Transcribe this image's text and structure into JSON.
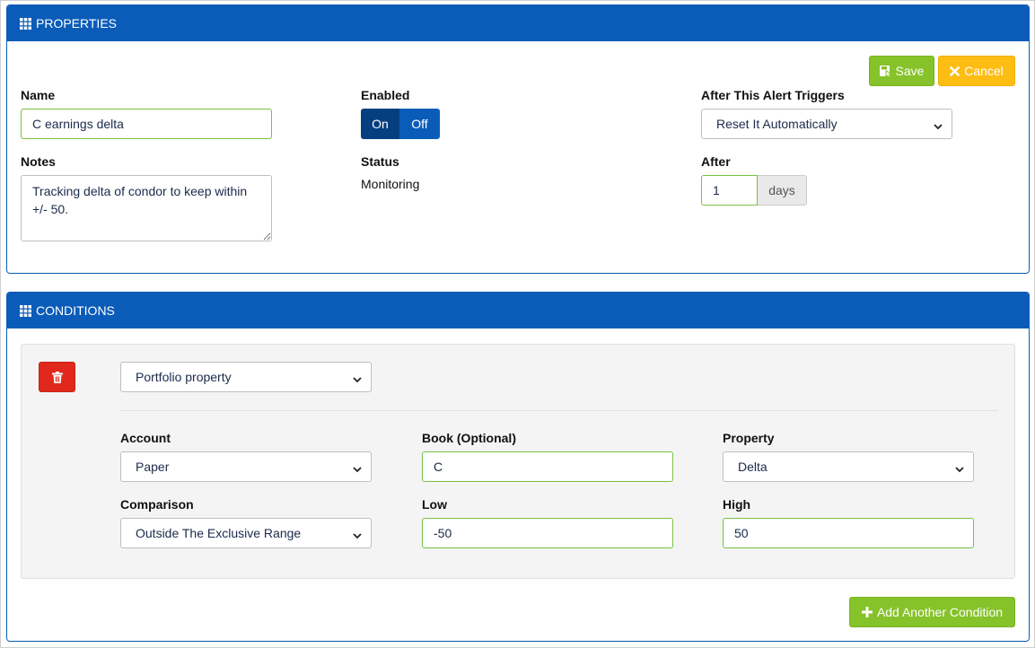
{
  "properties": {
    "header": "PROPERTIES",
    "save_label": "Save",
    "cancel_label": "Cancel",
    "name_label": "Name",
    "name_value": "C earnings delta",
    "notes_label": "Notes",
    "notes_value": "Tracking delta of condor to keep within +/- 50.",
    "enabled_label": "Enabled",
    "toggle_on": "On",
    "toggle_off": "Off",
    "status_label": "Status",
    "status_value": "Monitoring",
    "after_triggers_label": "After This Alert Triggers",
    "after_triggers_value": "Reset It Automatically",
    "after_label": "After",
    "after_value": "1",
    "after_unit": "days"
  },
  "conditions": {
    "header": "CONDITIONS",
    "condition_type": "Portfolio property",
    "account_label": "Account",
    "account_value": "Paper",
    "book_label": "Book (Optional)",
    "book_value": "C",
    "property_label": "Property",
    "property_value": "Delta",
    "comparison_label": "Comparison",
    "comparison_value": "Outside The Exclusive Range",
    "low_label": "Low",
    "low_value": "-50",
    "high_label": "High",
    "high_value": "50",
    "add_condition_label": "Add Another Condition"
  },
  "colors": {
    "header_blue": "#0b5cb8",
    "accent_green": "#86c22a",
    "cancel_yellow": "#fdbd13",
    "delete_red": "#e0281c"
  }
}
